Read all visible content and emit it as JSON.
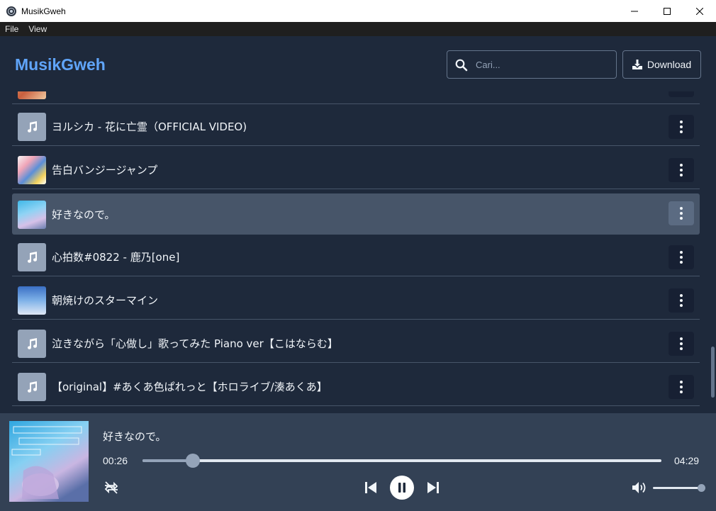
{
  "window": {
    "title": "MusikGweh"
  },
  "menu": {
    "file": "File",
    "view": "View"
  },
  "header": {
    "brand": "MusikGweh",
    "search_placeholder": "Cari...",
    "download_label": "Download"
  },
  "tracks": [
    {
      "title": "",
      "thumb": "art-orange"
    },
    {
      "title": "ヨルシカ - 花に亡霊（OFFICIAL VIDEO)",
      "thumb": "music-note-icon"
    },
    {
      "title": "告白バンジージャンプ",
      "thumb": "art-anime-group"
    },
    {
      "title": "好きなので。",
      "thumb": "art-plastic-memories",
      "active": true
    },
    {
      "title": "心拍数#0822 - 鹿乃[one]",
      "thumb": "music-note-icon"
    },
    {
      "title": "朝焼けのスターマイン",
      "thumb": "art-blue-sky"
    },
    {
      "title": "泣きながら「心做し」歌ってみた Piano ver【こはならむ】",
      "thumb": "music-note-icon"
    },
    {
      "title": "【original】#あくあ色ぱれっと【ホロライブ/湊あくあ】",
      "thumb": "music-note-icon"
    }
  ],
  "player": {
    "now_playing": "好きなので。",
    "current_time": "00:26",
    "duration": "04:29",
    "progress_fraction": 0.097,
    "volume_fraction": 1.0,
    "cover": "art-plastic-memories"
  },
  "colors": {
    "brand": "#60a5fa",
    "background": "#1e293b",
    "active_row": "#475569",
    "player_bg": "#334155"
  }
}
